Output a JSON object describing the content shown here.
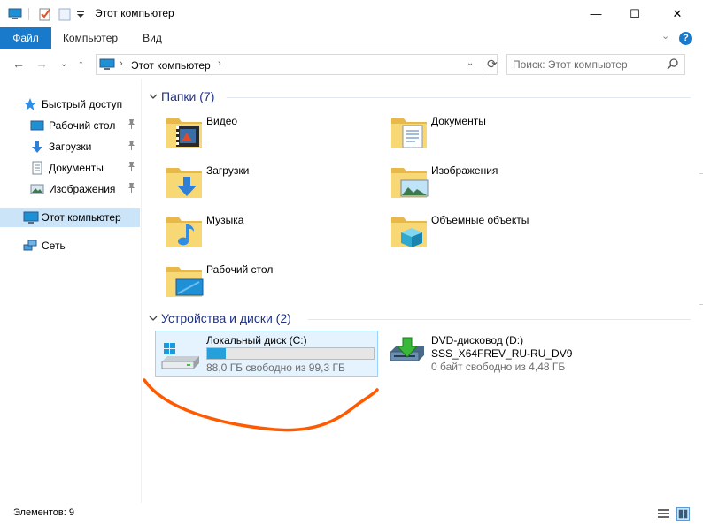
{
  "window": {
    "title": "Этот компьютер",
    "minimize": "—",
    "maximize": "☐",
    "close": "✕"
  },
  "ribbon": {
    "tabs": [
      "Файл",
      "Компьютер",
      "Вид"
    ],
    "help": "?",
    "expand": "⌄"
  },
  "address": {
    "location": "Этот компьютер",
    "separator": "›",
    "back": "←",
    "forward": "→",
    "recent": "⌄",
    "up": "↑",
    "dropdown": "⌄",
    "refresh": "⟳"
  },
  "search": {
    "placeholder": "Поиск: Этот компьютер"
  },
  "sidebar": {
    "items": [
      {
        "label": "Быстрый доступ",
        "icon": "star-icon"
      },
      {
        "label": "Рабочий стол",
        "icon": "desktop-icon",
        "pinned": true
      },
      {
        "label": "Загрузки",
        "icon": "download-icon",
        "pinned": true
      },
      {
        "label": "Документы",
        "icon": "documents-icon",
        "pinned": true
      },
      {
        "label": "Изображения",
        "icon": "pictures-icon",
        "pinned": true
      },
      {
        "label": "Этот компьютер",
        "icon": "computer-icon",
        "selected": true
      },
      {
        "label": "Сеть",
        "icon": "network-icon"
      }
    ],
    "pin_glyph": "📌"
  },
  "groups": {
    "folders": {
      "title": "Папки (7)",
      "items": [
        {
          "name": "Видео",
          "icon": "video-folder-icon"
        },
        {
          "name": "Документы",
          "icon": "documents-folder-icon"
        },
        {
          "name": "Загрузки",
          "icon": "downloads-folder-icon"
        },
        {
          "name": "Изображения",
          "icon": "pictures-folder-icon"
        },
        {
          "name": "Музыка",
          "icon": "music-folder-icon"
        },
        {
          "name": "Объемные объекты",
          "icon": "3d-objects-folder-icon"
        },
        {
          "name": "Рабочий стол",
          "icon": "desktop-folder-icon"
        }
      ]
    },
    "drives": {
      "title": "Устройства и диски (2)",
      "items": [
        {
          "name": "Локальный диск (C:)",
          "free": "88,0 ГБ свободно из 99,3 ГБ",
          "used_fraction": 0.114,
          "icon": "hard-drive-icon"
        },
        {
          "name": "DVD-дисковод (D:)",
          "label": "SSS_X64FREV_RU-RU_DV9",
          "free": "0 байт свободно из 4,48 ГБ",
          "icon": "dvd-drive-icon"
        }
      ]
    }
  },
  "status": {
    "items_count": "Элементов: 9"
  },
  "colors": {
    "accent": "#1979ca",
    "selection": "#cce4f7",
    "group_header": "#1e3287",
    "drive_bar": "#26a0da",
    "annotation": "#ff5a00",
    "folder": "#f8d775"
  }
}
